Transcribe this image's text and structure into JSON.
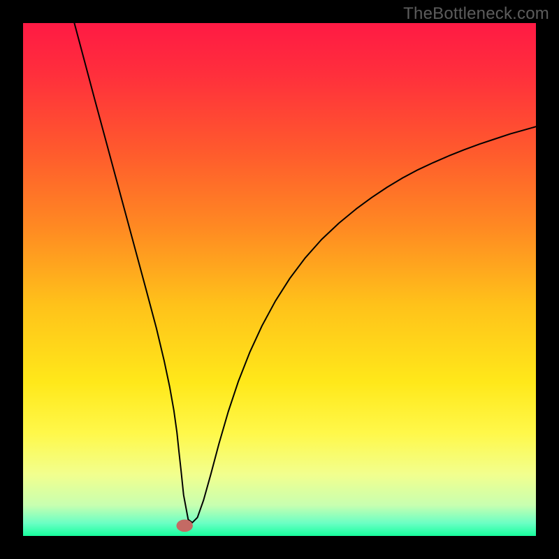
{
  "watermark": {
    "text": "TheBottleneck.com"
  },
  "chart_data": {
    "type": "line",
    "title": "",
    "xlabel": "",
    "ylabel": "",
    "xlim": [
      0,
      100
    ],
    "ylim": [
      0,
      100
    ],
    "grid": false,
    "background_gradient": {
      "stops": [
        {
          "offset": 0.0,
          "color": "#ff1a44"
        },
        {
          "offset": 0.1,
          "color": "#ff2f3c"
        },
        {
          "offset": 0.25,
          "color": "#ff5a2d"
        },
        {
          "offset": 0.4,
          "color": "#ff8a22"
        },
        {
          "offset": 0.55,
          "color": "#ffc21a"
        },
        {
          "offset": 0.7,
          "color": "#ffe81a"
        },
        {
          "offset": 0.8,
          "color": "#fff84a"
        },
        {
          "offset": 0.88,
          "color": "#f2ff8e"
        },
        {
          "offset": 0.94,
          "color": "#c8ffb0"
        },
        {
          "offset": 0.975,
          "color": "#6bffc4"
        },
        {
          "offset": 1.0,
          "color": "#18ff9e"
        }
      ]
    },
    "marker": {
      "x": 31.5,
      "y": 2,
      "color": "#c46a64",
      "rx": 1.6,
      "ry": 1.2
    },
    "series": [
      {
        "name": "curve",
        "color": "#000000",
        "stroke_width": 2,
        "x": [
          10.0,
          12.0,
          14.0,
          16.0,
          18.0,
          20.0,
          22.0,
          24.0,
          26.0,
          27.5,
          28.6,
          29.4,
          30.0,
          30.4,
          30.8,
          31.3,
          32.2,
          33.0,
          34.0,
          35.2,
          36.6,
          38.2,
          40.0,
          42.0,
          44.2,
          46.6,
          49.2,
          52.0,
          55.0,
          58.2,
          61.6,
          65.0,
          68.0,
          71.0,
          74.0,
          77.0,
          80.0,
          83.0,
          86.0,
          89.0,
          92.0,
          95.0,
          97.5,
          100.0
        ],
        "values": [
          100.0,
          92.5,
          85.0,
          77.6,
          70.2,
          62.8,
          55.4,
          48.0,
          40.5,
          34.2,
          29.0,
          24.5,
          20.2,
          16.4,
          12.8,
          8.0,
          3.2,
          2.6,
          3.6,
          7.0,
          12.0,
          18.0,
          24.2,
          30.2,
          35.8,
          41.0,
          45.8,
          50.2,
          54.2,
          57.8,
          61.0,
          63.8,
          66.0,
          68.0,
          69.8,
          71.4,
          72.8,
          74.1,
          75.3,
          76.4,
          77.4,
          78.4,
          79.1,
          79.8
        ]
      }
    ]
  }
}
